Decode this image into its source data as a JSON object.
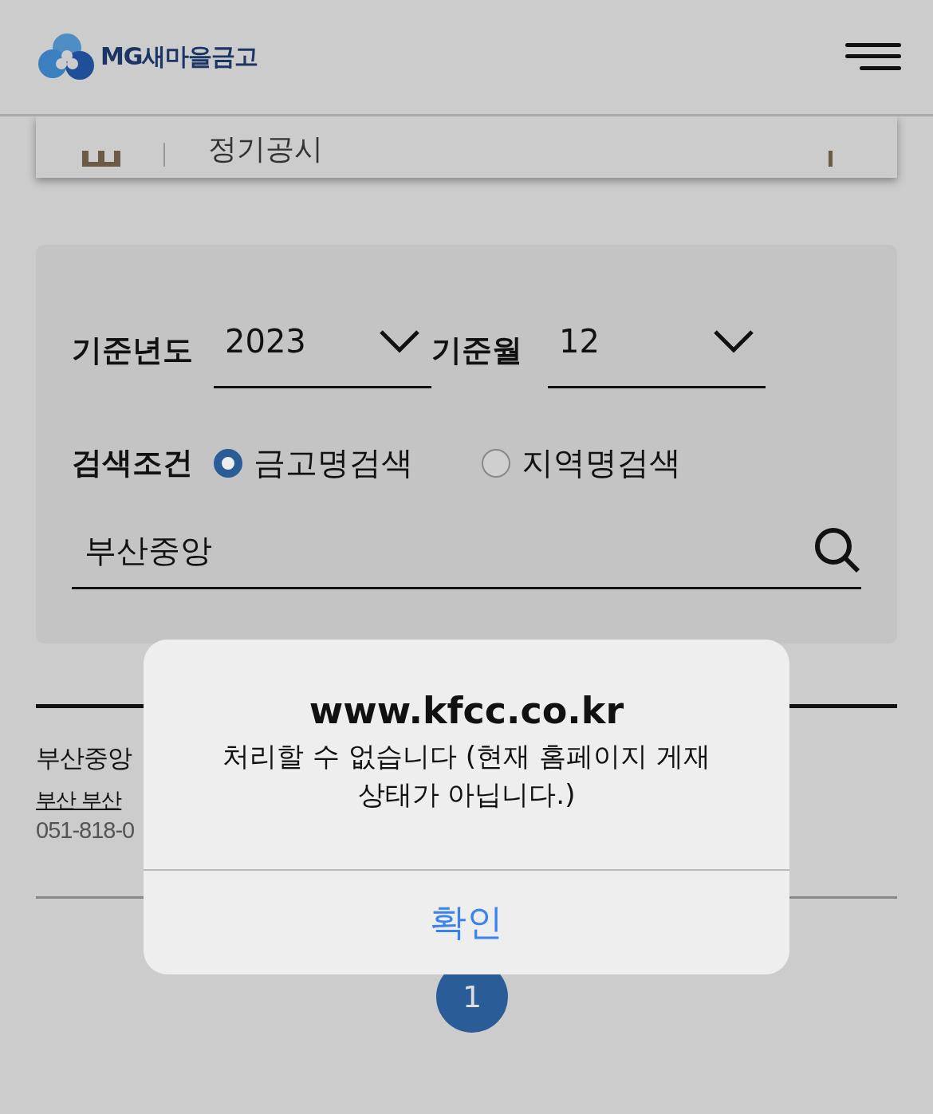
{
  "header": {
    "logo_text": "MG새마을금고"
  },
  "notice_card": {
    "title": "정기공시"
  },
  "search": {
    "year_label": "기준년도",
    "year_value": "2023",
    "month_label": "기준월",
    "month_value": "12",
    "condition_label": "검색조건",
    "options": [
      {
        "label": "금고명검색",
        "selected": true
      },
      {
        "label": "지역명검색",
        "selected": false
      }
    ],
    "query": "부산중앙"
  },
  "result": {
    "name": "부산중앙",
    "address": "부산 부산",
    "phone": "051-818-0"
  },
  "pagination": [
    {
      "label": "1",
      "selected": true
    }
  ],
  "dialog": {
    "title": "www.kfcc.co.kr",
    "message": "처리할 수 없습니다 (현재 홈페이지 게재 상태가 아닙니다.)",
    "button": "확인"
  }
}
